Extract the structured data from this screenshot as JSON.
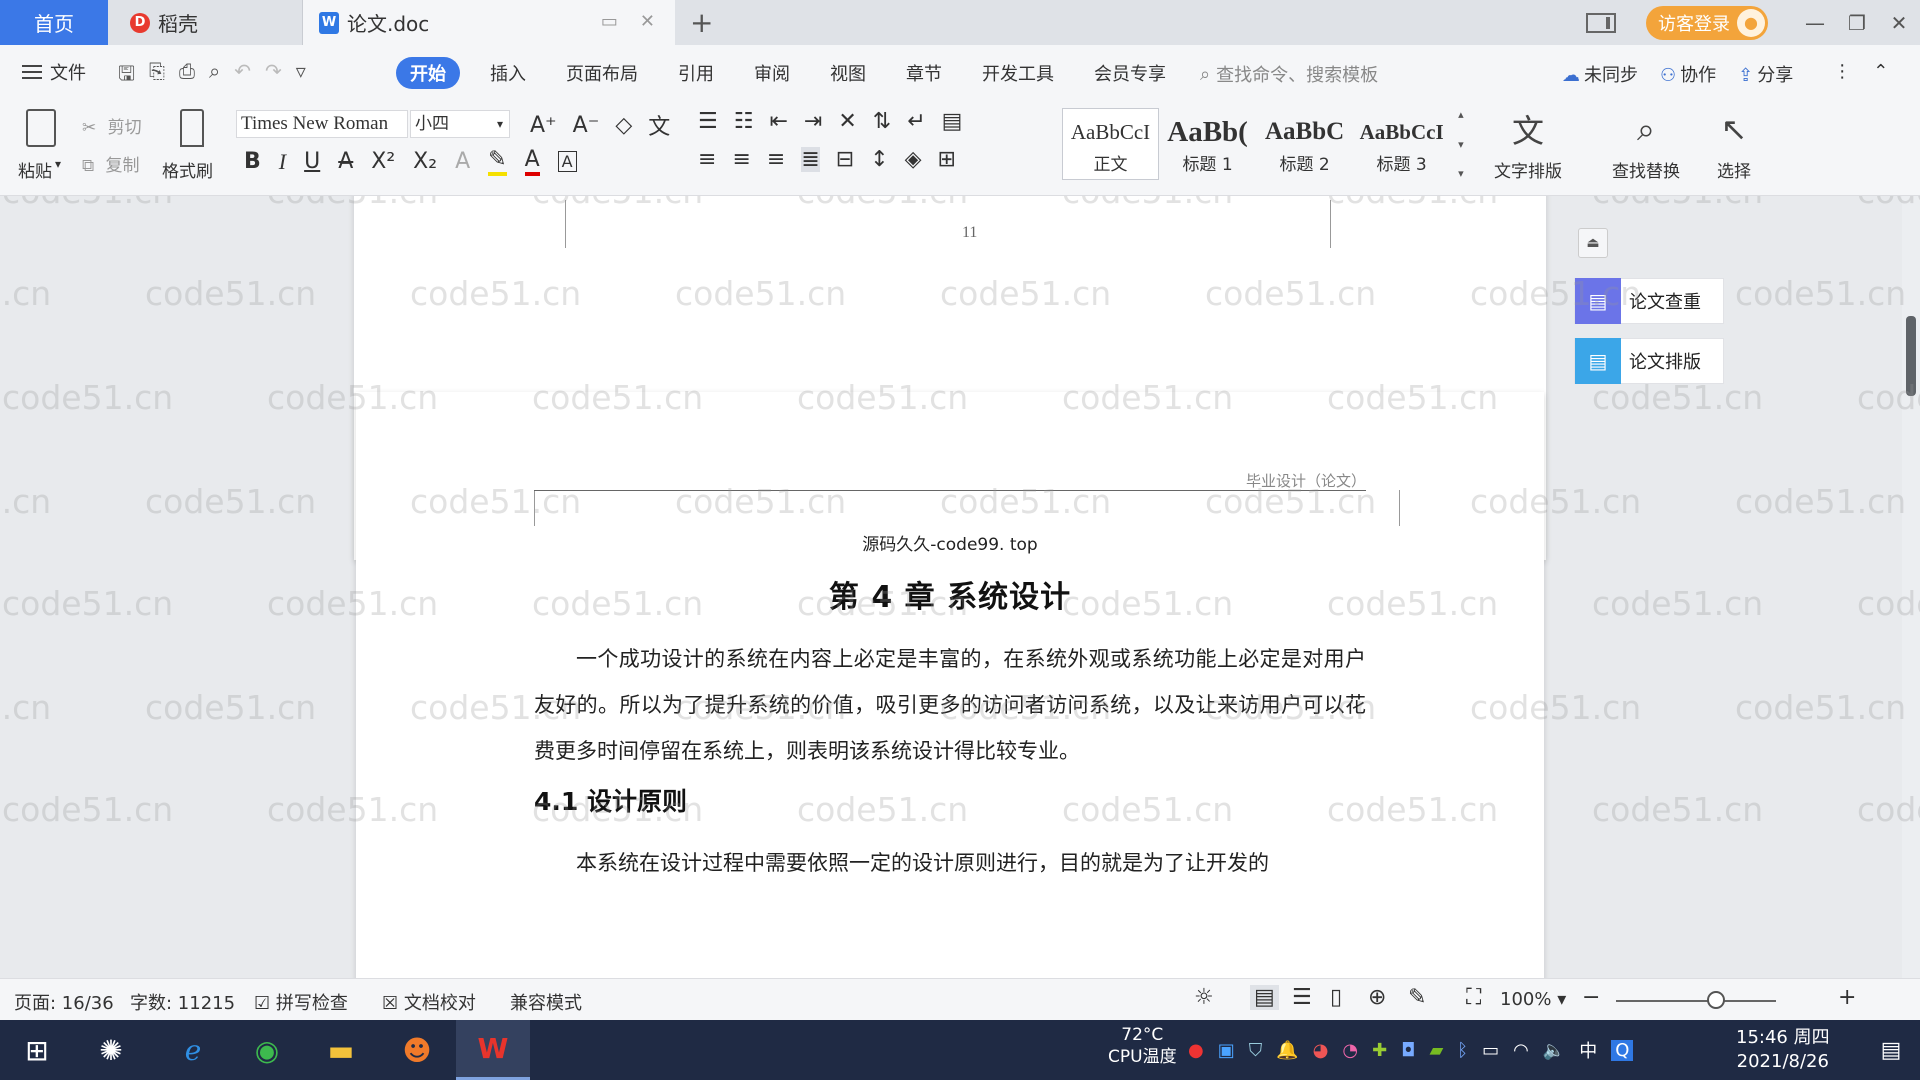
{
  "tabs": {
    "home": "首页",
    "daoke": "稻壳",
    "document": "论文.doc",
    "add": "+"
  },
  "window": {
    "login": "访客登录",
    "minimize": "—",
    "restore": "❐",
    "close": "✕"
  },
  "menu": {
    "file": "文件",
    "items": [
      "开始",
      "插入",
      "页面布局",
      "引用",
      "审阅",
      "视图",
      "章节",
      "开发工具",
      "会员专享"
    ],
    "active": "开始",
    "search": "查找命令、搜索模板",
    "sync": "未同步",
    "collab": "协作",
    "share": "分享"
  },
  "ribbon": {
    "paste": "粘贴",
    "cut": "剪切",
    "copy": "复制",
    "format_painter": "格式刷",
    "font_name": "Times New Roman",
    "font_size": "小四",
    "styles": [
      {
        "sample": "AaBbCcI",
        "label": "正文"
      },
      {
        "sample": "AaBb(",
        "label": "标题 1"
      },
      {
        "sample": "AaBbC",
        "label": "标题 2"
      },
      {
        "sample": "AaBbCcI",
        "label": "标题 3"
      }
    ],
    "text_layout": "文字排版",
    "find_replace": "查找替换",
    "select": "选择"
  },
  "document": {
    "page_number": "11",
    "header_text": "毕业设计（论文）",
    "source_line": "源码久久-code99. top",
    "chapter_title": "第 4 章  系统设计",
    "paragraph1": "一个成功设计的系统在内容上必定是丰富的，在系统外观或系统功能上必定是对用户友好的。所以为了提升系统的价值，吸引更多的访问者访问系统，以及让来访用户可以花费更多时间停留在系统上，则表明该系统设计得比较专业。",
    "section_title": "4.1  设计原则",
    "paragraph2": "本系统在设计过程中需要依照一定的设计原则进行，目的就是为了让开发的",
    "watermark": "code51.cn"
  },
  "side_panel": {
    "check": "论文查重",
    "layout": "论文排版"
  },
  "status": {
    "page": "页面: 16/36",
    "words": "字数: 11215",
    "spell": "拼写检查",
    "proof": "文档校对",
    "compat": "兼容模式",
    "zoom": "100%"
  },
  "taskbar": {
    "cpu_temp": "72°C",
    "cpu_label": "CPU温度",
    "time": "15:46 周四",
    "date": "2021/8/26",
    "ime": "中"
  },
  "colors": {
    "accent": "#3b78e7",
    "login": "#f3a43b",
    "taskbar": "#1f2a44"
  }
}
